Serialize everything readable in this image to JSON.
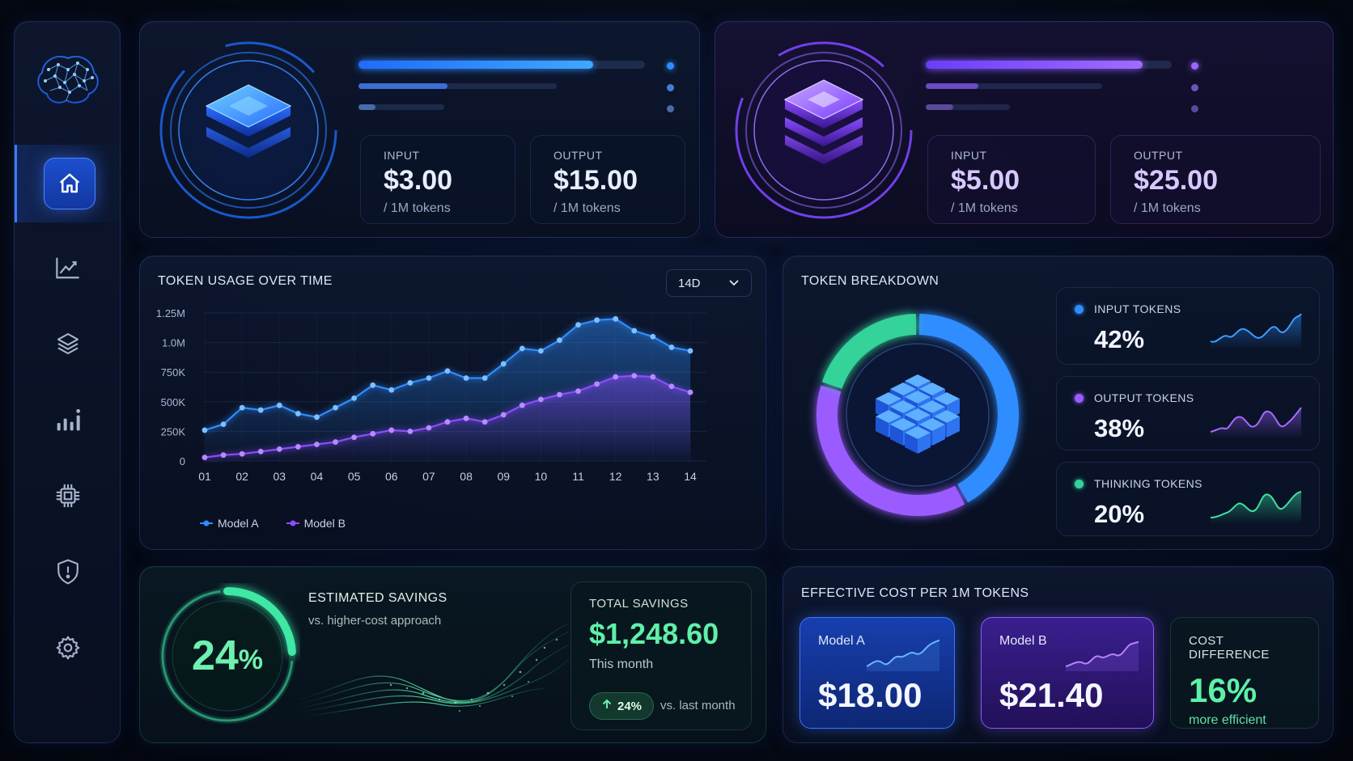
{
  "sidebar": {
    "items": [
      {
        "name": "home",
        "icon": "home-icon",
        "active": true
      },
      {
        "name": "analytics",
        "icon": "line-chart-icon",
        "active": false
      },
      {
        "name": "models",
        "icon": "layers-icon",
        "active": false
      },
      {
        "name": "reports",
        "icon": "bar-chart-icon",
        "active": false
      },
      {
        "name": "compute",
        "icon": "chip-icon",
        "active": false
      },
      {
        "name": "security",
        "icon": "shield-icon",
        "active": false
      },
      {
        "name": "settings",
        "icon": "gear-icon",
        "active": false
      }
    ],
    "logo": "brain-icon"
  },
  "model_a_card": {
    "accent": "#3d8bff",
    "input_label": "INPUT",
    "input_price": "$3.00",
    "input_unit": "/ 1M tokens",
    "output_label": "OUTPUT",
    "output_price": "$15.00",
    "output_unit": "/ 1M tokens",
    "bar_levels": [
      0.82,
      0.45,
      0.2
    ]
  },
  "model_b_card": {
    "accent": "#8b5cff",
    "input_label": "INPUT",
    "input_price": "$5.00",
    "input_unit": "/ 1M tokens",
    "output_label": "OUTPUT",
    "output_price": "$25.00",
    "output_unit": "/ 1M tokens",
    "bar_levels": [
      0.88,
      0.3,
      0.33
    ]
  },
  "usage": {
    "title": "TOKEN USAGE OVER TIME",
    "range": "14D",
    "legend": [
      "Model A",
      "Model B"
    ]
  },
  "chart_data": {
    "type": "area",
    "title": "TOKEN USAGE OVER TIME",
    "x": [
      "01",
      "02",
      "03",
      "04",
      "05",
      "06",
      "07",
      "08",
      "09",
      "10",
      "11",
      "12",
      "13",
      "14"
    ],
    "yticks": [
      "0",
      "250K",
      "500K",
      "750K",
      "1.0M",
      "1.25M"
    ],
    "ylim": [
      0,
      1250000
    ],
    "series": [
      {
        "name": "Model A",
        "color": "#2f8dff",
        "values": [
          260000,
          310000,
          450000,
          430000,
          470000,
          400000,
          370000,
          450000,
          530000,
          640000,
          600000,
          660000,
          700000,
          760000,
          700000,
          700000,
          820000,
          950000,
          930000,
          1020000,
          1150000,
          1190000,
          1200000,
          1100000,
          1050000,
          960000,
          930000
        ],
        "xpos": [
          1,
          1.5,
          2,
          2.5,
          3,
          3.5,
          4,
          4.5,
          5,
          5.5,
          6,
          6.5,
          7,
          7.5,
          8,
          8.5,
          9,
          9.5,
          10,
          10.5,
          11,
          11.5,
          12,
          12.5,
          13,
          13.5,
          14
        ]
      },
      {
        "name": "Model B",
        "color": "#8a4dff",
        "values": [
          30000,
          50000,
          60000,
          80000,
          100000,
          120000,
          140000,
          160000,
          200000,
          230000,
          260000,
          250000,
          280000,
          330000,
          360000,
          330000,
          390000,
          470000,
          520000,
          560000,
          590000,
          650000,
          710000,
          720000,
          710000,
          630000,
          580000
        ],
        "xpos": [
          1,
          1.5,
          2,
          2.5,
          3,
          3.5,
          4,
          4.5,
          5,
          5.5,
          6,
          6.5,
          7,
          7.5,
          8,
          8.5,
          9,
          9.5,
          10,
          10.5,
          11,
          11.5,
          12,
          12.5,
          13,
          13.5,
          14
        ]
      }
    ],
    "legend_position": "bottom-left",
    "grid": true
  },
  "breakdown": {
    "title": "TOKEN BREAKDOWN",
    "items": [
      {
        "label": "INPUT TOKENS",
        "value": "42%",
        "pct": 42,
        "color": "#2f8dff"
      },
      {
        "label": "OUTPUT TOKENS",
        "value": "38%",
        "pct": 38,
        "color": "#9b5cff"
      },
      {
        "label": "THINKING TOKENS",
        "value": "20%",
        "pct": 20,
        "color": "#34d399"
      }
    ]
  },
  "savings": {
    "title": "ESTIMATED SAVINGS",
    "subtitle": "vs. higher-cost approach",
    "ring_value": "24",
    "ring_unit": "%",
    "ring_level": 0.24,
    "total_label": "TOTAL SAVINGS",
    "total_value": "$1,248.60",
    "total_period": "This month",
    "change": "24%",
    "change_note": "vs. last month"
  },
  "effective": {
    "title": "EFFECTIVE COST PER 1M TOKENS",
    "model_a_label": "Model A",
    "model_a_value": "$18.00",
    "model_b_label": "Model B",
    "model_b_value": "$21.40",
    "diff_label": "COST DIFFERENCE",
    "diff_value": "16%",
    "diff_note": "more efficient"
  }
}
